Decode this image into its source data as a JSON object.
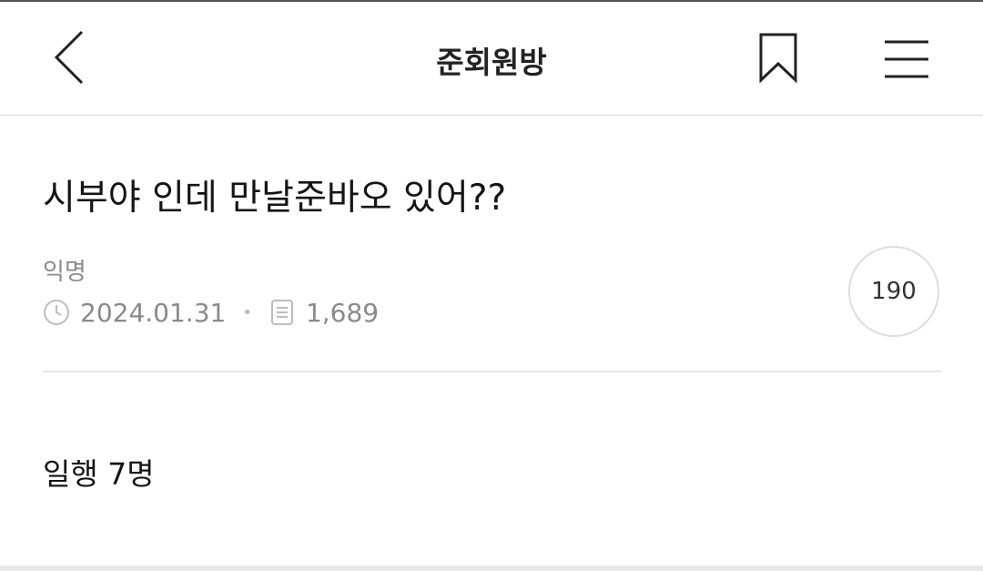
{
  "header": {
    "title": "준회원방",
    "back_icon": "chevron-left-icon",
    "bookmark_icon": "bookmark-icon",
    "menu_icon": "hamburger-menu-icon"
  },
  "post": {
    "title": "시부야 인데 만날준바오 있어??",
    "author": "익명",
    "date": "2024.01.31",
    "separator": "•",
    "views": "1,689",
    "comment_count": "190",
    "body": "일행 7명"
  },
  "colors": {
    "text_primary": "#151515",
    "text_secondary": "#8a8a8a",
    "divider": "#e6e6e6"
  }
}
